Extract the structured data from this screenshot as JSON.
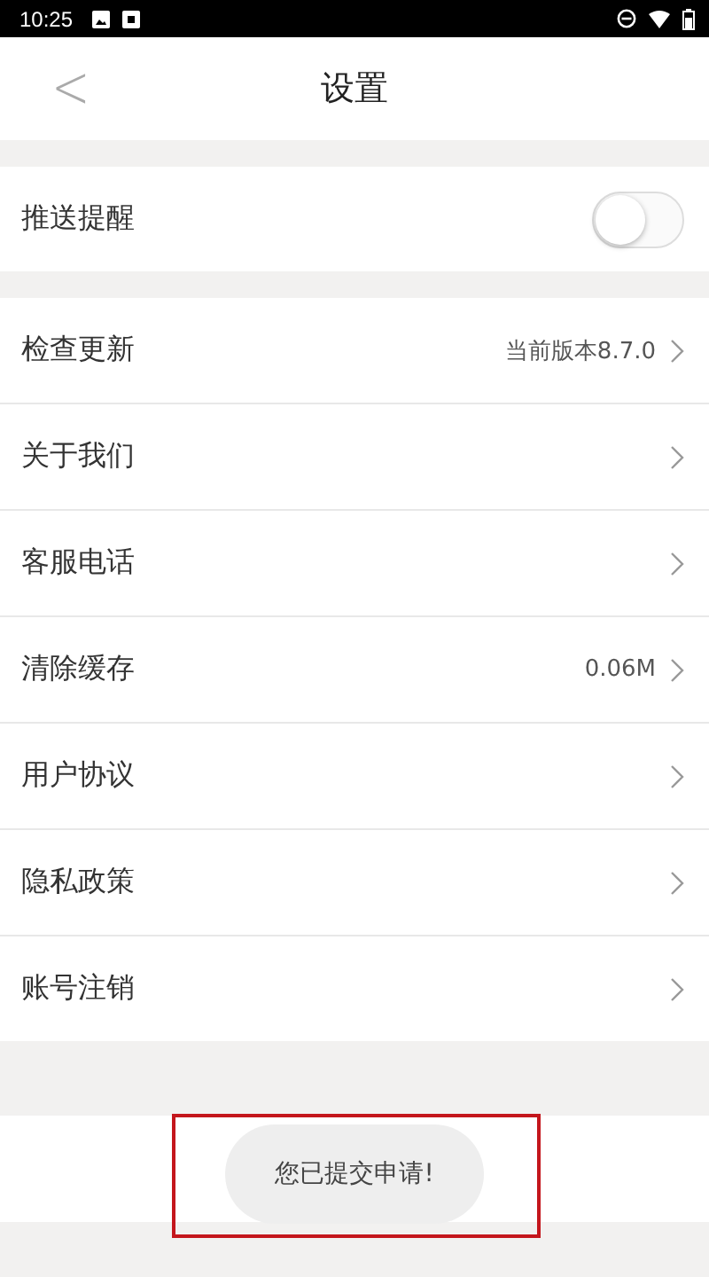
{
  "status_bar": {
    "time": "10:25"
  },
  "header": {
    "back": "<",
    "title": "设置"
  },
  "push": {
    "label": "推送提醒",
    "on": false
  },
  "items": [
    {
      "label": "检查更新",
      "value": "当前版本8.7.0"
    },
    {
      "label": "关于我们"
    },
    {
      "label": "客服电话"
    },
    {
      "label": "清除缓存",
      "value": "0.06M"
    },
    {
      "label": "用户协议"
    },
    {
      "label": "隐私政策"
    },
    {
      "label": "账号注销"
    }
  ],
  "toast": {
    "message": "您已提交申请!"
  }
}
